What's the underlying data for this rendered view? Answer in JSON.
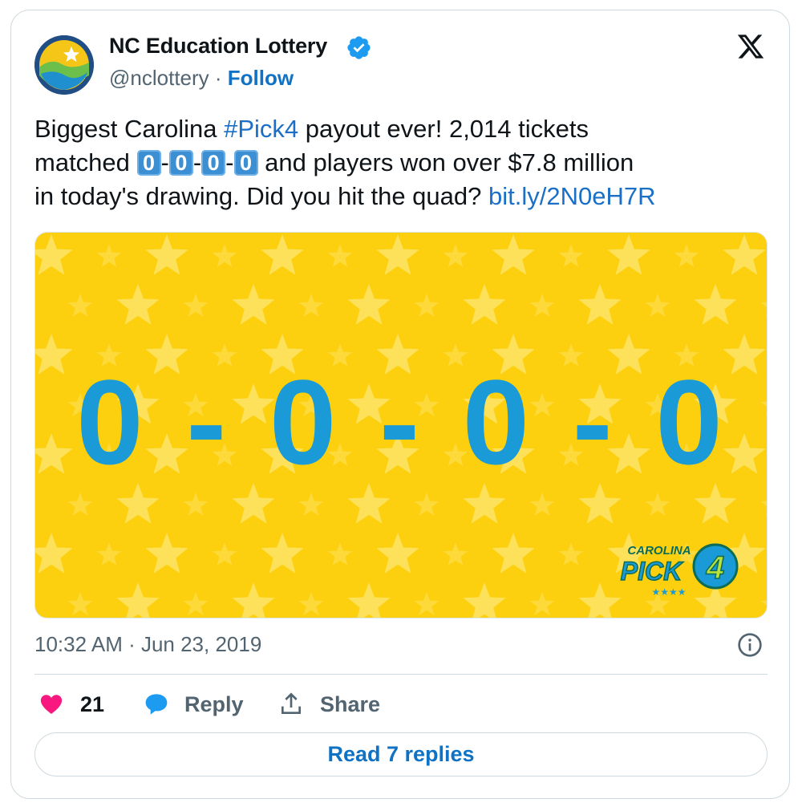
{
  "account": {
    "name": "NC Education Lottery",
    "handle": "@nclottery",
    "separator": "·",
    "follow_label": "Follow"
  },
  "tweet": {
    "line1_a": "Biggest Carolina ",
    "hashtag": "#Pick4",
    "line1_b": " payout ever! 2,014 tickets",
    "line2_a": "matched ",
    "keycaps": [
      "0",
      "0",
      "0",
      "0"
    ],
    "dash": "-",
    "line2_b": " and players won over $7.8 million",
    "line3_a": "in today's drawing. Did you hit the quad? ",
    "link": "bit.ly/2N0eH7R"
  },
  "media": {
    "draw_number": "0 - 0 - 0 - 0",
    "logo_top": "CAROLINA",
    "logo_main": "PICK",
    "logo_digit": "4",
    "logo_stars": "★★★★"
  },
  "timestamp": "10:32 AM · Jun 23, 2019",
  "actions": {
    "like_count": "21",
    "reply_label": "Reply",
    "share_label": "Share"
  },
  "read_replies_label": "Read 7 replies",
  "colors": {
    "link_blue": "#1b6fc6",
    "media_yellow": "#fdd00f",
    "number_blue": "#1a9ad6",
    "like_pink": "#f91880"
  },
  "icons": [
    "verified-badge-icon",
    "x-logo-icon",
    "info-icon",
    "heart-icon",
    "reply-bubble-icon",
    "share-icon"
  ]
}
